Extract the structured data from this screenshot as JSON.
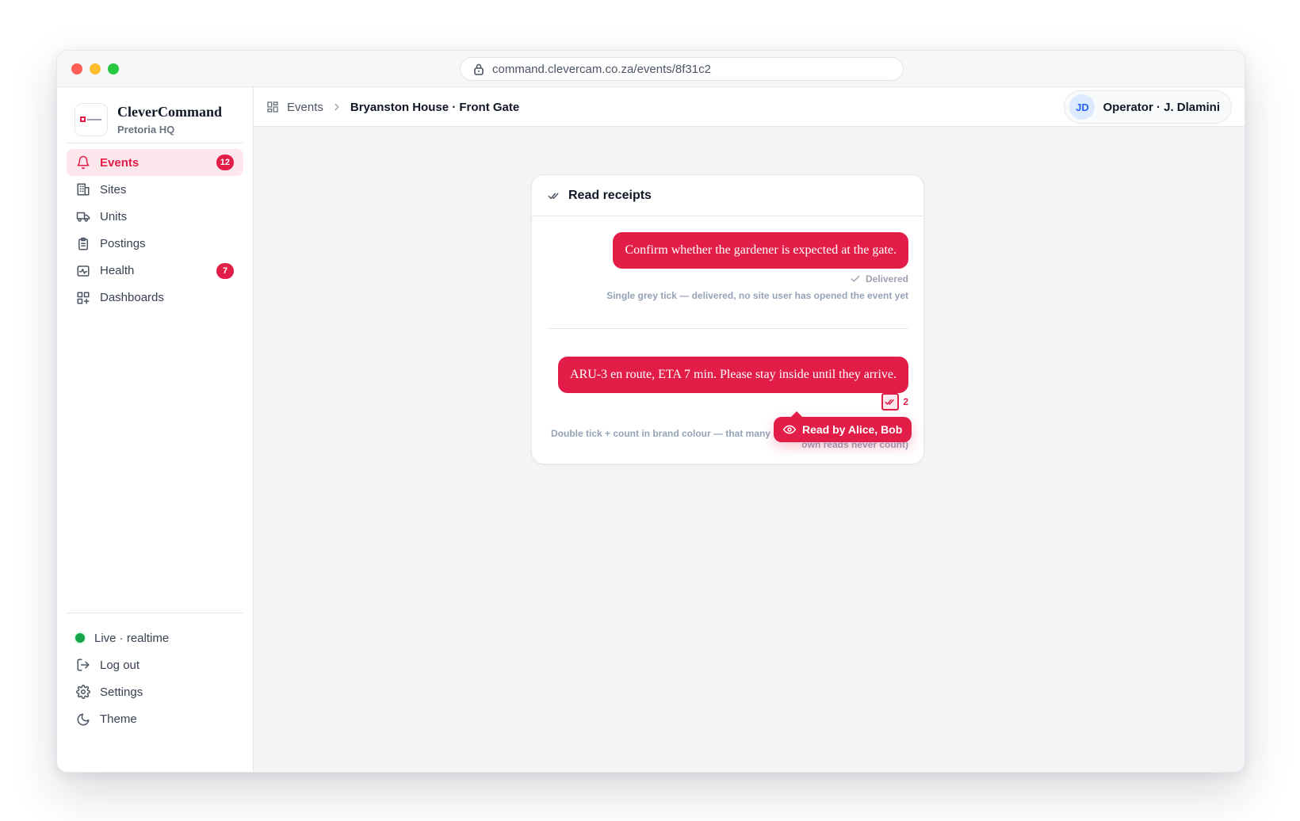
{
  "browser": {
    "url": "command.clevercam.co.za/events/8f31c2"
  },
  "brand": {
    "name": "CleverCommand",
    "subtitle": "Pretoria HQ"
  },
  "nav": [
    {
      "label": "Events",
      "icon": "bell-icon",
      "badge": "12",
      "active": true
    },
    {
      "label": "Sites",
      "icon": "building-icon"
    },
    {
      "label": "Units",
      "icon": "truck-icon"
    },
    {
      "label": "Postings",
      "icon": "clipboard-icon"
    },
    {
      "label": "Health",
      "icon": "activity-icon",
      "badge": "7"
    },
    {
      "label": "Dashboards",
      "icon": "dashboard-grid-icon"
    }
  ],
  "bottom_nav": [
    {
      "label": "Live · realtime",
      "icon": "live-status-dot"
    },
    {
      "label": "Log out",
      "icon": "logout-icon"
    },
    {
      "label": "Settings",
      "icon": "gear-icon"
    },
    {
      "label": "Theme",
      "icon": "moon-icon"
    }
  ],
  "breadcrumb": {
    "root": "Events",
    "current": "Bryanston House · Front Gate"
  },
  "user": {
    "initials": "JD",
    "label": "Operator · J. Dlamini"
  },
  "card": {
    "title": "Read receipts",
    "messages": [
      {
        "text": "Confirm whether the gardener is expected at the gate.",
        "status": "Delivered",
        "note": "Single grey tick — delivered, no site user has opened the event yet"
      },
      {
        "text": "ARU-3 en route, ETA 7 min. Please stay inside until they arrive.",
        "read_count": "2",
        "note_line1": "Double tick + count in brand colour — that many c",
        "note_line2": "own reads never count)",
        "tooltip": "Read by Alice, Bob"
      }
    ]
  },
  "colors": {
    "brand": "#e11d48",
    "live": "#16a34a"
  }
}
